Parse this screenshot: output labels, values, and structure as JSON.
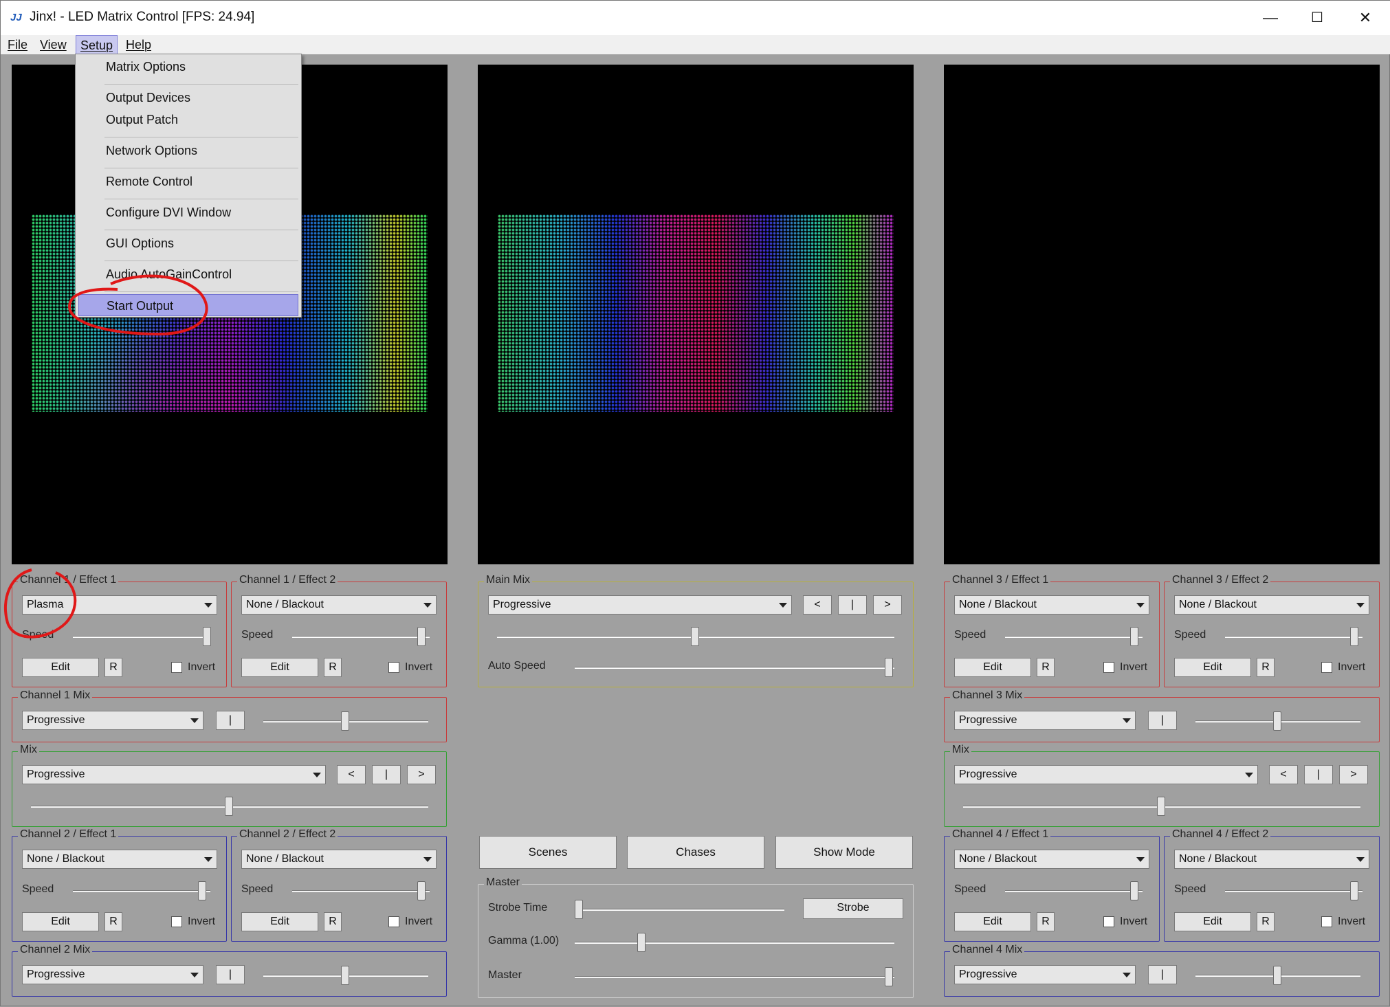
{
  "window": {
    "title": "Jinx! - LED Matrix Control [FPS: 24.94]",
    "app_icon": "jinx-logo-icon",
    "minimize": "—",
    "maximize": "☐",
    "close": "✕"
  },
  "menubar": {
    "file": "File",
    "view": "View",
    "setup": "Setup",
    "help": "Help"
  },
  "setup_menu": {
    "items": [
      "Matrix Options",
      "Output Devices",
      "Output Patch",
      "Network Options",
      "Remote Control",
      "Configure DVI Window",
      "GUI Options",
      "Audio AutoGainControl",
      "Start Output"
    ],
    "highlighted": "Start Output"
  },
  "common": {
    "speed": "Speed",
    "edit": "Edit",
    "r": "R",
    "invert": "Invert",
    "prev": "<",
    "pause": "|",
    "next": ">",
    "progressive": "Progressive",
    "none_blackout": "None / Blackout"
  },
  "left": {
    "ch1e1": {
      "label": "Channel 1 / Effect 1",
      "effect": "Plasma",
      "speed": 0.97,
      "invert": false
    },
    "ch1e2": {
      "label": "Channel 1 / Effect 2",
      "effect": "None / Blackout",
      "speed": 0.97,
      "invert": false
    },
    "ch1mix": {
      "label": "Channel 1 Mix",
      "mode": "Progressive",
      "value": 0.5
    },
    "mix": {
      "label": "Mix",
      "mode": "Progressive",
      "value": 0.5
    },
    "ch2e1": {
      "label": "Channel 2 / Effect 1",
      "effect": "None / Blackout",
      "speed": 0.97,
      "invert": false
    },
    "ch2e2": {
      "label": "Channel 2 / Effect 2",
      "effect": "None / Blackout",
      "speed": 0.97,
      "invert": false
    },
    "ch2mix": {
      "label": "Channel 2 Mix",
      "mode": "Progressive",
      "value": 0.5
    }
  },
  "center": {
    "main_mix": {
      "label": "Main Mix",
      "mode": "Progressive",
      "value": 0.5,
      "auto_speed_label": "Auto Speed",
      "auto_speed": 1.0
    },
    "scenes": "Scenes",
    "chases": "Chases",
    "show_mode": "Show Mode",
    "master": {
      "label": "Master",
      "strobe_time": "Strobe Time",
      "strobe": "Strobe",
      "gamma": "Gamma (1.00)",
      "master": "Master",
      "strobe_value": 0.0,
      "gamma_value": 0.25,
      "master_value": 1.0
    }
  },
  "right": {
    "ch3e1": {
      "label": "Channel 3 / Effect 1",
      "effect": "None / Blackout",
      "speed": 0.97,
      "invert": false
    },
    "ch3e2": {
      "label": "Channel 3 / Effect 2",
      "effect": "None / Blackout",
      "speed": 0.97,
      "invert": false
    },
    "ch3mix": {
      "label": "Channel 3 Mix",
      "mode": "Progressive",
      "value": 0.5
    },
    "mix": {
      "label": "Mix",
      "mode": "Progressive",
      "value": 0.5
    },
    "ch4e1": {
      "label": "Channel 4 / Effect 1",
      "effect": "None / Blackout",
      "speed": 0.97,
      "invert": false
    },
    "ch4e2": {
      "label": "Channel 4 / Effect 2",
      "effect": "None / Blackout",
      "speed": 0.97,
      "invert": false
    },
    "ch4mix": {
      "label": "Channel 4 Mix",
      "mode": "Progressive",
      "value": 0.5
    }
  },
  "colors": {
    "red_group": "#c83c3c",
    "green_group": "#35a035",
    "blue_group": "#3636a8",
    "yellow_group": "#b8b03a",
    "menu_highlight": "#a6a6ea",
    "annotation": "#e01818"
  }
}
